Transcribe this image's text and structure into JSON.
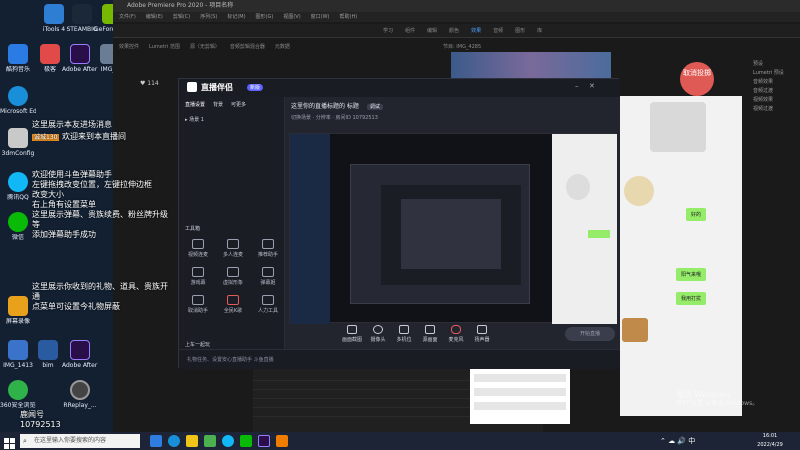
{
  "desktop": {
    "icons_col1": [
      "iTools 4",
      "STEAMBIG",
      "GeForce Experience"
    ],
    "icons_col2": [
      "酷狗音乐",
      "极客",
      "Adobe After Effects 2020",
      "IMG_1"
    ],
    "icons_left": [
      "Microsoft Edge",
      "3dmConfig",
      "腾讯QQ",
      "微信",
      "屏幕录像",
      "IMG_1413",
      "360安全浏览器"
    ],
    "icons_bottom": [
      "IMG_1413",
      "bim",
      "Adobe After Effects 2020",
      "RReplay_...",
      "360安全浏览器"
    ],
    "like_count": "114"
  },
  "premiere": {
    "title": "Adobe Premiere Pro 2020 - 项目名称",
    "menu": [
      "文件(F)",
      "编辑(E)",
      "剪辑(C)",
      "序列(S)",
      "标记(M)",
      "图形(G)",
      "视图(V)",
      "窗口(W)",
      "帮助(H)"
    ],
    "workspaces": [
      "学习",
      "组件",
      "编辑",
      "颜色",
      "效果",
      "音频",
      "图形",
      "库"
    ],
    "panel_tabs": [
      "效果控件",
      "Lumetri 范围",
      "源（无剪辑）",
      "音频剪辑混合器",
      "元数据"
    ],
    "program_label": "节目: IMG_4285",
    "effects_items": [
      "预设",
      "Lumetri 预设",
      "音频效果",
      "音频过渡",
      "视频效果",
      "视频过渡"
    ],
    "timeline_time": "00:00:00:00"
  },
  "overlay": {
    "line1": "这里展示本友进场消息",
    "line2_user": "诚城130",
    "line2_msg": "欢迎来到本直播间",
    "block2": [
      "欢迎使用斗鱼弹幕助手",
      "左键拖拽改变位置，左键拉伸边框",
      "改变大小",
      "右上角有设置菜单",
      "这里展示弹幕、贵族续费、粉丝牌升级",
      "等",
      "添加弹幕助手成功"
    ],
    "block3": [
      "这里展示你收到的礼物、道具、贵族开通",
      "点菜单可设置今礼物屏蔽"
    ],
    "streamer_name": "鹿闻号",
    "room_id": "10792513"
  },
  "game": {
    "cancel_button": "取消投掷"
  },
  "chat": {
    "messages": [
      "微信",
      "好的",
      "阳气来哦",
      "我用打扰"
    ]
  },
  "companion": {
    "title": "直播伴侣",
    "badge": "新版",
    "tabs": [
      "直播设置",
      "背景",
      "可更多"
    ],
    "scene": "场景 1",
    "stream_title": "这里你的直播标题的 标题",
    "stream_tag": "调试",
    "info_line": "切换场景 · 分辨率 · 房间ID 10792513",
    "tools_heading": "工具箱",
    "tools": [
      "视频连麦",
      "多人连麦",
      "推荐助手",
      "游戏幕",
      "虚拟形象",
      "弹幕姬",
      "取消助手",
      "全民K歌",
      "人力工具"
    ],
    "bottom_link": "上车一起玩",
    "controls": [
      "画面截图",
      "摄像头",
      "多机位",
      "源画面",
      "麦克风",
      "扬声器"
    ],
    "go_live": "开始直播",
    "footer_text": "礼物任务、设置安心直播助手   斗鱼直播"
  },
  "taskbar": {
    "search_placeholder": "在这里输入你要搜索的内容",
    "time": "16:01",
    "date": "2022/4/29"
  },
  "watermark": {
    "line1": "激活 Windows",
    "line2": "转到\"设置\"以激活 Windows。"
  }
}
